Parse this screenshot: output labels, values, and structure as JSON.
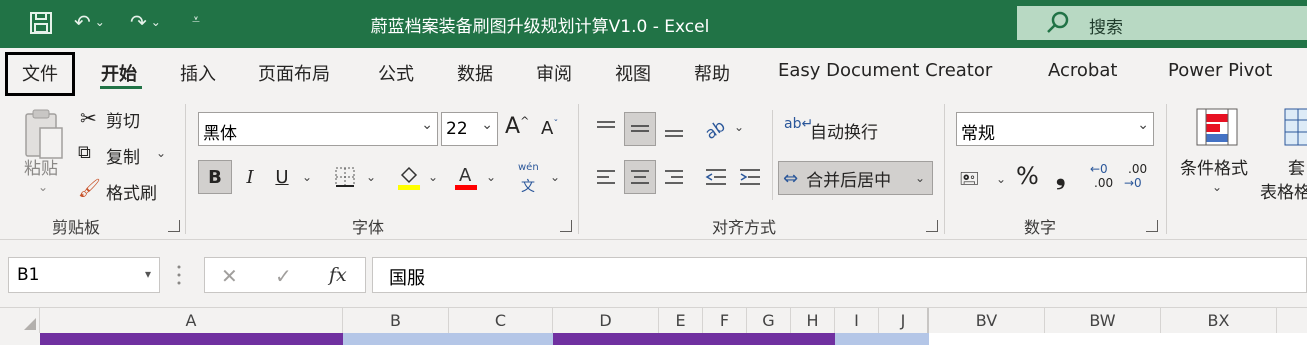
{
  "window": {
    "title": "蔚蓝档案装备刷图升级规划计算V1.0  -  Excel",
    "search_label": "搜索"
  },
  "colors": {
    "titlebar_bg": "#217346",
    "accent": "#217346",
    "purple_cell": "#7030a0",
    "lavender_cell": "#b4c6e7"
  },
  "tabs": [
    {
      "label": "文件"
    },
    {
      "label": "开始",
      "active": true
    },
    {
      "label": "插入"
    },
    {
      "label": "页面布局"
    },
    {
      "label": "公式"
    },
    {
      "label": "数据"
    },
    {
      "label": "审阅"
    },
    {
      "label": "视图"
    },
    {
      "label": "帮助"
    },
    {
      "label": "Easy Document Creator"
    },
    {
      "label": "Acrobat"
    },
    {
      "label": "Power Pivot"
    }
  ],
  "clipboard": {
    "group_label": "剪贴板",
    "paste": "粘贴",
    "cut": "剪切",
    "copy": "复制",
    "format_painter": "格式刷"
  },
  "font": {
    "group_label": "字体",
    "font_name": "黑体",
    "font_size": "22",
    "bold": "B",
    "italic": "I",
    "underline": "U",
    "phonetic_top": "wén",
    "phonetic_bottom": "文"
  },
  "alignment": {
    "group_label": "对齐方式",
    "wrap_text": "自动换行",
    "merge_center": "合并后居中"
  },
  "number": {
    "group_label": "数字",
    "format": "常规",
    "percent": "%",
    "comma": "❟",
    "inc_decimal": ".00",
    "dec_decimal": ".00"
  },
  "styles": {
    "conditional_format": "条件格式",
    "table_format_line1": "套",
    "table_format_line2": "表格格"
  },
  "formula_bar": {
    "name_box": "B1",
    "cancel": "✕",
    "enter": "✓",
    "fx": "fx",
    "value": "国服"
  },
  "columns": [
    "A",
    "B",
    "C",
    "D",
    "E",
    "F",
    "G",
    "H",
    "I",
    "J",
    "BV",
    "BW",
    "BX"
  ]
}
